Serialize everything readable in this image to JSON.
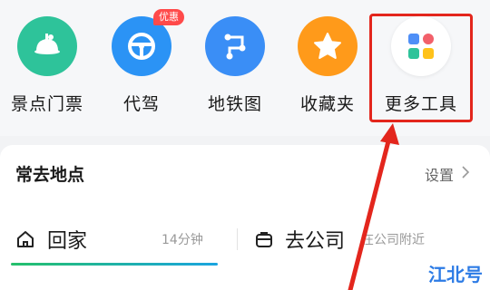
{
  "tools": [
    {
      "label": "景点门票",
      "icon": "attraction-ticket-icon",
      "color": "#2ec39a"
    },
    {
      "label": "代驾",
      "icon": "steering-wheel-icon",
      "color": "#2b93f5",
      "badge": "优惠"
    },
    {
      "label": "地铁图",
      "icon": "metro-route-icon",
      "color": "#3a8ef6"
    },
    {
      "label": "收藏夹",
      "icon": "star-icon",
      "color": "#ff9a1a"
    },
    {
      "label": "更多工具",
      "icon": "more-tools-icon",
      "color": "#ffffff"
    }
  ],
  "places": {
    "title": "常去地点",
    "settings_label": "设置",
    "items": [
      {
        "name": "回家",
        "meta": "14分钟",
        "icon": "home-icon"
      },
      {
        "name": "去公司",
        "meta": "在公司附近",
        "icon": "briefcase-icon"
      }
    ],
    "commute_progress": 1.0
  },
  "watermark": "江北号",
  "colors": {
    "highlight": "#e3261d",
    "accent_blue": "#2c7be5"
  }
}
